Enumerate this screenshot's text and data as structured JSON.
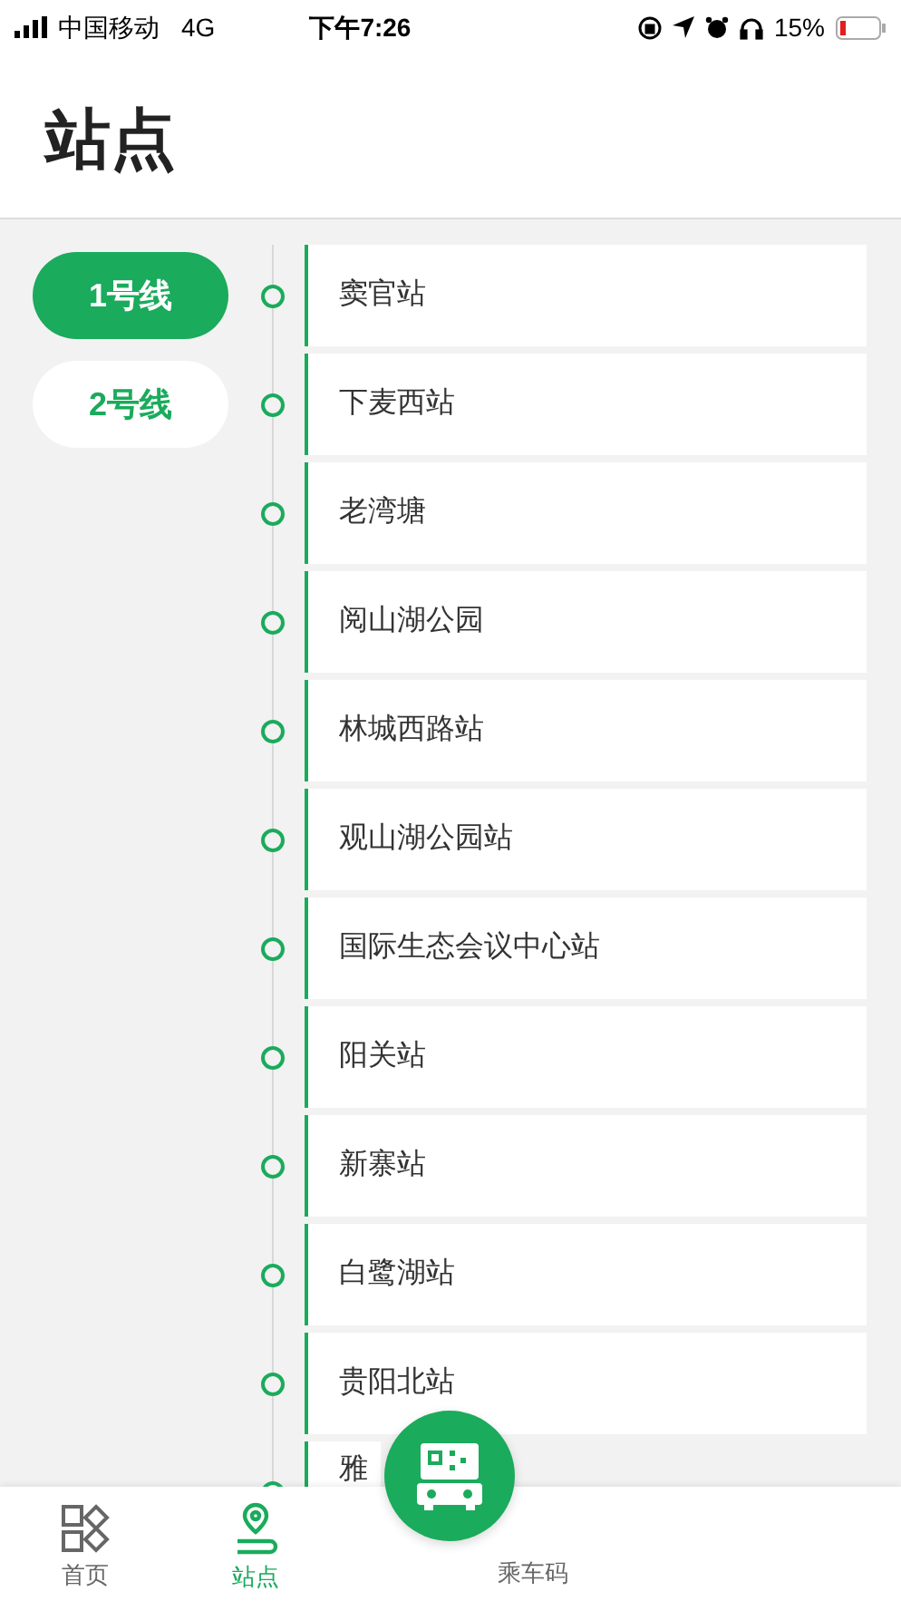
{
  "status_bar": {
    "carrier": "中国移动",
    "network": "4G",
    "time": "下午7:26",
    "battery": "15%"
  },
  "title": "站点",
  "lines": [
    {
      "label": "1号线",
      "selected": true
    },
    {
      "label": "2号线",
      "selected": false
    }
  ],
  "stations": [
    "窦官站",
    "下麦西站",
    "老湾塘",
    "阅山湖公园",
    "林城西路站",
    "观山湖公园站",
    "国际生态会议中心站",
    "阳关站",
    "新寨站",
    "白鹭湖站",
    "贵阳北站",
    "雅"
  ],
  "tab_bar": [
    {
      "kind": "home",
      "label": "首页",
      "selected": false
    },
    {
      "kind": "stations",
      "label": "站点",
      "selected": true
    },
    {
      "kind": "code",
      "label": "乘车码",
      "selected": false
    }
  ]
}
